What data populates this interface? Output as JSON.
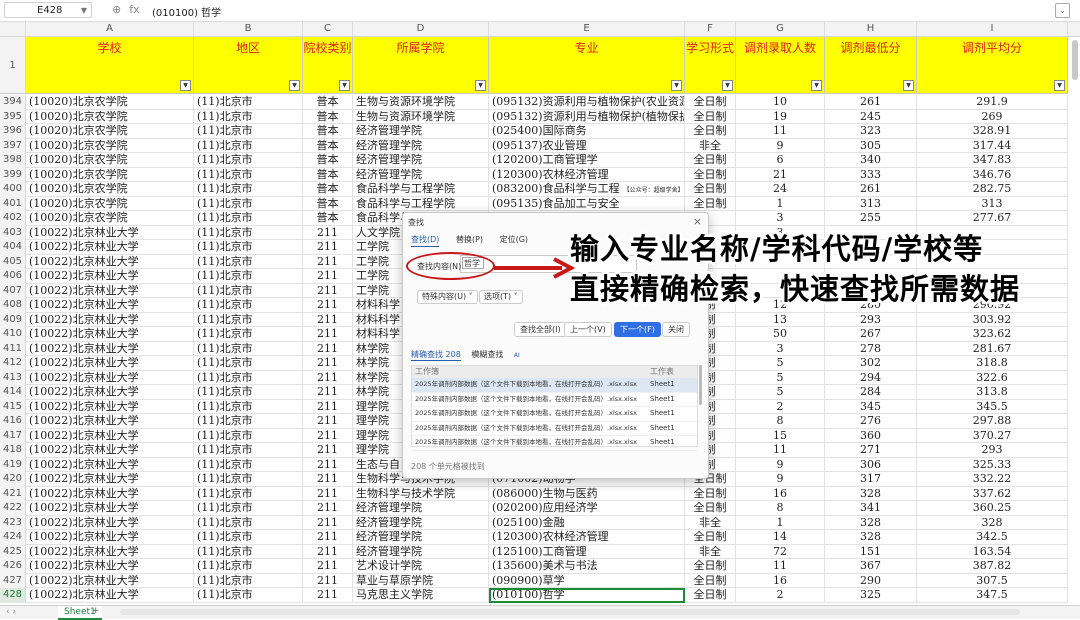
{
  "formula_bar": {
    "cell_ref": "E428",
    "content": "(010100) 哲学",
    "fx": "fx"
  },
  "columns": [
    "A",
    "B",
    "C",
    "D",
    "E",
    "F",
    "G",
    "H",
    "I"
  ],
  "header_row_num": "1",
  "headers": [
    "学校",
    "地区",
    "院校类别",
    "所属学院",
    "专业",
    "学习形式",
    "调剂录取人数",
    "调剂最低分",
    "调剂平均分"
  ],
  "rows": [
    {
      "n": "394",
      "a": "(10020)北京农学院",
      "b": "(11)北京市",
      "c": "普本",
      "d": "生物与资源环境学院",
      "e": "(095132)资源利用与植物保护(农业资源",
      "f": "全日制",
      "g": "10",
      "h": "261",
      "i": "291.9"
    },
    {
      "n": "395",
      "a": "(10020)北京农学院",
      "b": "(11)北京市",
      "c": "普本",
      "d": "生物与资源环境学院",
      "e": "(095132)资源利用与植物保护(植物保护",
      "f": "全日制",
      "g": "19",
      "h": "245",
      "i": "269"
    },
    {
      "n": "396",
      "a": "(10020)北京农学院",
      "b": "(11)北京市",
      "c": "普本",
      "d": "经济管理学院",
      "e": "(025400)国际商务",
      "f": "全日制",
      "g": "11",
      "h": "323",
      "i": "328.91"
    },
    {
      "n": "397",
      "a": "(10020)北京农学院",
      "b": "(11)北京市",
      "c": "普本",
      "d": "经济管理学院",
      "e": "(095137)农业管理",
      "f": "非全",
      "g": "9",
      "h": "305",
      "i": "317.44"
    },
    {
      "n": "398",
      "a": "(10020)北京农学院",
      "b": "(11)北京市",
      "c": "普本",
      "d": "经济管理学院",
      "e": "(120200)工商管理学",
      "f": "全日制",
      "g": "6",
      "h": "340",
      "i": "347.83"
    },
    {
      "n": "399",
      "a": "(10020)北京农学院",
      "b": "(11)北京市",
      "c": "普本",
      "d": "经济管理学院",
      "e": "(120300)农林经济管理",
      "f": "全日制",
      "g": "21",
      "h": "333",
      "i": "346.76"
    },
    {
      "n": "400",
      "a": "(10020)北京农学院",
      "b": "(11)北京市",
      "c": "普本",
      "d": "食品科学与工程学院",
      "e": "(083200)食品科学与工程",
      "e_note": "【公众号：超级学舍】",
      "f": "全日制",
      "g": "24",
      "h": "261",
      "i": "282.75"
    },
    {
      "n": "401",
      "a": "(10020)北京农学院",
      "b": "(11)北京市",
      "c": "普本",
      "d": "食品科学与工程学院",
      "e": "(095135)食品加工与安全",
      "f": "全日制",
      "g": "1",
      "h": "313",
      "i": "313"
    },
    {
      "n": "402",
      "a": "(10020)北京农学院",
      "b": "(11)北京市",
      "c": "普本",
      "d": "食品科学与工",
      "e": "",
      "f": "",
      "g": "3",
      "h": "255",
      "i": "277.67"
    },
    {
      "n": "403",
      "a": "(10022)北京林业大学",
      "b": "(11)北京市",
      "c": "211",
      "d": "人文学院",
      "e": "",
      "f": "",
      "g": "3",
      "h": "",
      "i": ""
    },
    {
      "n": "404",
      "a": "(10022)北京林业大学",
      "b": "(11)北京市",
      "c": "211",
      "d": "工学院",
      "e": "",
      "f": "",
      "g": "",
      "h": "",
      "i": ""
    },
    {
      "n": "405",
      "a": "(10022)北京林业大学",
      "b": "(11)北京市",
      "c": "211",
      "d": "工学院",
      "e": "",
      "f": "",
      "g": "",
      "h": "",
      "i": ""
    },
    {
      "n": "406",
      "a": "(10022)北京林业大学",
      "b": "(11)北京市",
      "c": "211",
      "d": "工学院",
      "e": "",
      "f": "",
      "g": "",
      "h": "",
      "i": ""
    },
    {
      "n": "407",
      "a": "(10022)北京林业大学",
      "b": "(11)北京市",
      "c": "211",
      "d": "工学院",
      "e": "",
      "f": "",
      "g": "",
      "h": "",
      "i": ""
    },
    {
      "n": "408",
      "a": "(10022)北京林业大学",
      "b": "(11)北京市",
      "c": "211",
      "d": "材料科学",
      "e": "",
      "f": "制",
      "g": "12",
      "h": "280",
      "i": "296.92"
    },
    {
      "n": "409",
      "a": "(10022)北京林业大学",
      "b": "(11)北京市",
      "c": "211",
      "d": "材料科学",
      "e": "",
      "f": "制",
      "g": "13",
      "h": "293",
      "i": "303.92"
    },
    {
      "n": "410",
      "a": "(10022)北京林业大学",
      "b": "(11)北京市",
      "c": "211",
      "d": "材料科学",
      "e": "",
      "f": "制",
      "g": "50",
      "h": "267",
      "i": "323.62"
    },
    {
      "n": "411",
      "a": "(10022)北京林业大学",
      "b": "(11)北京市",
      "c": "211",
      "d": "林学院",
      "e": "",
      "f": "制",
      "g": "3",
      "h": "278",
      "i": "281.67"
    },
    {
      "n": "412",
      "a": "(10022)北京林业大学",
      "b": "(11)北京市",
      "c": "211",
      "d": "林学院",
      "e": "",
      "f": "制",
      "g": "5",
      "h": "302",
      "i": "318.8"
    },
    {
      "n": "413",
      "a": "(10022)北京林业大学",
      "b": "(11)北京市",
      "c": "211",
      "d": "林学院",
      "e": "",
      "f": "制",
      "g": "5",
      "h": "294",
      "i": "322.6"
    },
    {
      "n": "414",
      "a": "(10022)北京林业大学",
      "b": "(11)北京市",
      "c": "211",
      "d": "林学院",
      "e": "",
      "f": "制",
      "g": "5",
      "h": "284",
      "i": "313.8"
    },
    {
      "n": "415",
      "a": "(10022)北京林业大学",
      "b": "(11)北京市",
      "c": "211",
      "d": "理学院",
      "e": "",
      "f": "制",
      "g": "2",
      "h": "345",
      "i": "345.5"
    },
    {
      "n": "416",
      "a": "(10022)北京林业大学",
      "b": "(11)北京市",
      "c": "211",
      "d": "理学院",
      "e": "",
      "f": "制",
      "g": "8",
      "h": "276",
      "i": "297.88"
    },
    {
      "n": "417",
      "a": "(10022)北京林业大学",
      "b": "(11)北京市",
      "c": "211",
      "d": "理学院",
      "e": "",
      "f": "制",
      "g": "15",
      "h": "360",
      "i": "370.27"
    },
    {
      "n": "418",
      "a": "(10022)北京林业大学",
      "b": "(11)北京市",
      "c": "211",
      "d": "理学院",
      "e": "",
      "f": "制",
      "g": "11",
      "h": "271",
      "i": "293"
    },
    {
      "n": "419",
      "a": "(10022)北京林业大学",
      "b": "(11)北京市",
      "c": "211",
      "d": "生态与自",
      "e": "",
      "f": "制",
      "g": "9",
      "h": "306",
      "i": "325.33"
    },
    {
      "n": "420",
      "a": "(10022)北京林业大学",
      "b": "(11)北京市",
      "c": "211",
      "d": "生物科学与技术学院",
      "e": "(071002)动物学",
      "f": "全日制",
      "g": "9",
      "h": "317",
      "i": "332.22"
    },
    {
      "n": "421",
      "a": "(10022)北京林业大学",
      "b": "(11)北京市",
      "c": "211",
      "d": "生物科学与技术学院",
      "e": "(086000)生物与医药",
      "f": "全日制",
      "g": "16",
      "h": "328",
      "i": "337.62"
    },
    {
      "n": "422",
      "a": "(10022)北京林业大学",
      "b": "(11)北京市",
      "c": "211",
      "d": "经济管理学院",
      "e": "(020200)应用经济学",
      "f": "全日制",
      "g": "8",
      "h": "341",
      "i": "360.25"
    },
    {
      "n": "423",
      "a": "(10022)北京林业大学",
      "b": "(11)北京市",
      "c": "211",
      "d": "经济管理学院",
      "e": "(025100)金融",
      "f": "非全",
      "g": "1",
      "h": "328",
      "i": "328"
    },
    {
      "n": "424",
      "a": "(10022)北京林业大学",
      "b": "(11)北京市",
      "c": "211",
      "d": "经济管理学院",
      "e": "(120300)农林经济管理",
      "f": "全日制",
      "g": "14",
      "h": "328",
      "i": "342.5"
    },
    {
      "n": "425",
      "a": "(10022)北京林业大学",
      "b": "(11)北京市",
      "c": "211",
      "d": "经济管理学院",
      "e": "(125100)工商管理",
      "f": "非全",
      "g": "72",
      "h": "151",
      "i": "163.54"
    },
    {
      "n": "426",
      "a": "(10022)北京林业大学",
      "b": "(11)北京市",
      "c": "211",
      "d": "艺术设计学院",
      "e": "(135600)美术与书法",
      "f": "全日制",
      "g": "11",
      "h": "367",
      "i": "387.82"
    },
    {
      "n": "427",
      "a": "(10022)北京林业大学",
      "b": "(11)北京市",
      "c": "211",
      "d": "草业与草原学院",
      "e": "(090900)草学",
      "f": "全日制",
      "g": "16",
      "h": "290",
      "i": "307.5"
    },
    {
      "n": "428",
      "a": "(10022)北京林业大学",
      "b": "(11)北京市",
      "c": "211",
      "d": "马克思主义学院",
      "e": "(010100)哲学",
      "f": "全日制",
      "g": "2",
      "h": "325",
      "i": "347.5",
      "selected": true
    }
  ],
  "dialog": {
    "title": "查找",
    "tabs": [
      "查找(D)",
      "替换(P)",
      "定位(G)"
    ],
    "search_label": "查找内容(N)",
    "search_value": "哲学",
    "options": [
      "特殊内容(U) ˅",
      "选项(T) ˅"
    ],
    "actions": [
      "查找全部(I)",
      "上一个(V)",
      "下一个(F)",
      "关闭"
    ],
    "result_tabs": {
      "exact": "精确查找 208",
      "fuzzy": "模糊查找",
      "ai": "AI"
    },
    "result_cols": [
      "工作簿",
      "工作表"
    ],
    "results": [
      {
        "book": "2025年调剂内部数据（这个文件下载到本地看，在线打开会乱码）.xlsx.xlsx",
        "sheet": "Sheet1"
      },
      {
        "book": "2025年调剂内部数据（这个文件下载到本地看，在线打开会乱码）.xlsx.xlsx",
        "sheet": "Sheet1"
      },
      {
        "book": "2025年调剂内部数据（这个文件下载到本地看，在线打开会乱码）.xlsx.xlsx",
        "sheet": "Sheet1"
      },
      {
        "book": "2025年调剂内部数据（这个文件下载到本地看，在线打开会乱码）.xlsx.xlsx",
        "sheet": "Sheet1"
      },
      {
        "book": "2025年调剂内部数据（这个文件下载到本地看，在线打开会乱码）.xlsx.xlsx",
        "sheet": "Sheet1"
      }
    ],
    "footer": "208 个单元格被找到"
  },
  "overlay": {
    "line1": "输入专业名称/学科代码/学校等",
    "line2": "直接精确检索，快速查找所需数据"
  },
  "sheet_tab": "Sheet1",
  "accent": "#1c8c3b",
  "header_bg": "#ffff00",
  "header_text": "#e02020",
  "annotation_red": "#c81818"
}
